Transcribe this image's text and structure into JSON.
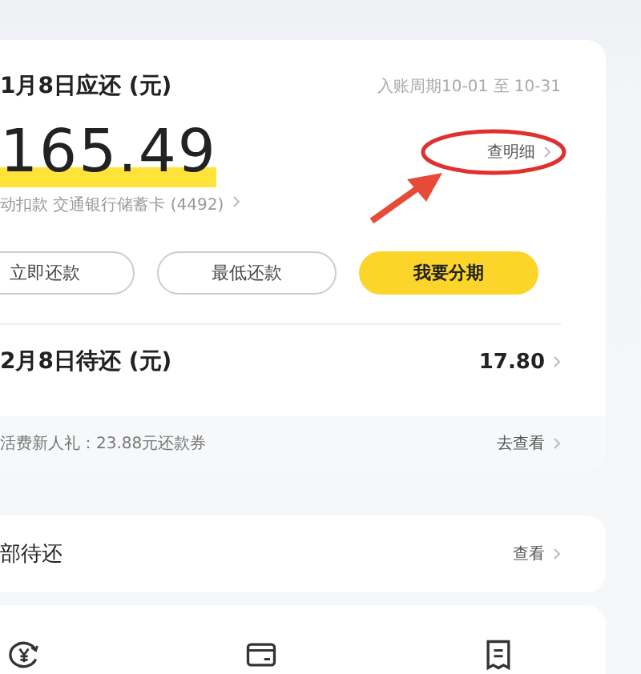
{
  "bill": {
    "title": "1月8日应还 (元)",
    "period": "入账周期10-01 至 10-31",
    "amount": "165.49",
    "detail_link": "查明细",
    "autopay": "动扣款 交通银行储蓄卡 (4492)"
  },
  "buttons": [
    {
      "label": "立即还款",
      "kind": "outline"
    },
    {
      "label": "最低还款",
      "kind": "outline"
    },
    {
      "label": "我要分期",
      "kind": "primary"
    }
  ],
  "next_bill": {
    "title": "2月8日待还 (元)",
    "amount": "17.80"
  },
  "promo": {
    "text": "活费新人礼：23.88元还款券",
    "link": "去查看"
  },
  "all_pending": {
    "title": "部待还",
    "link": "查看"
  }
}
